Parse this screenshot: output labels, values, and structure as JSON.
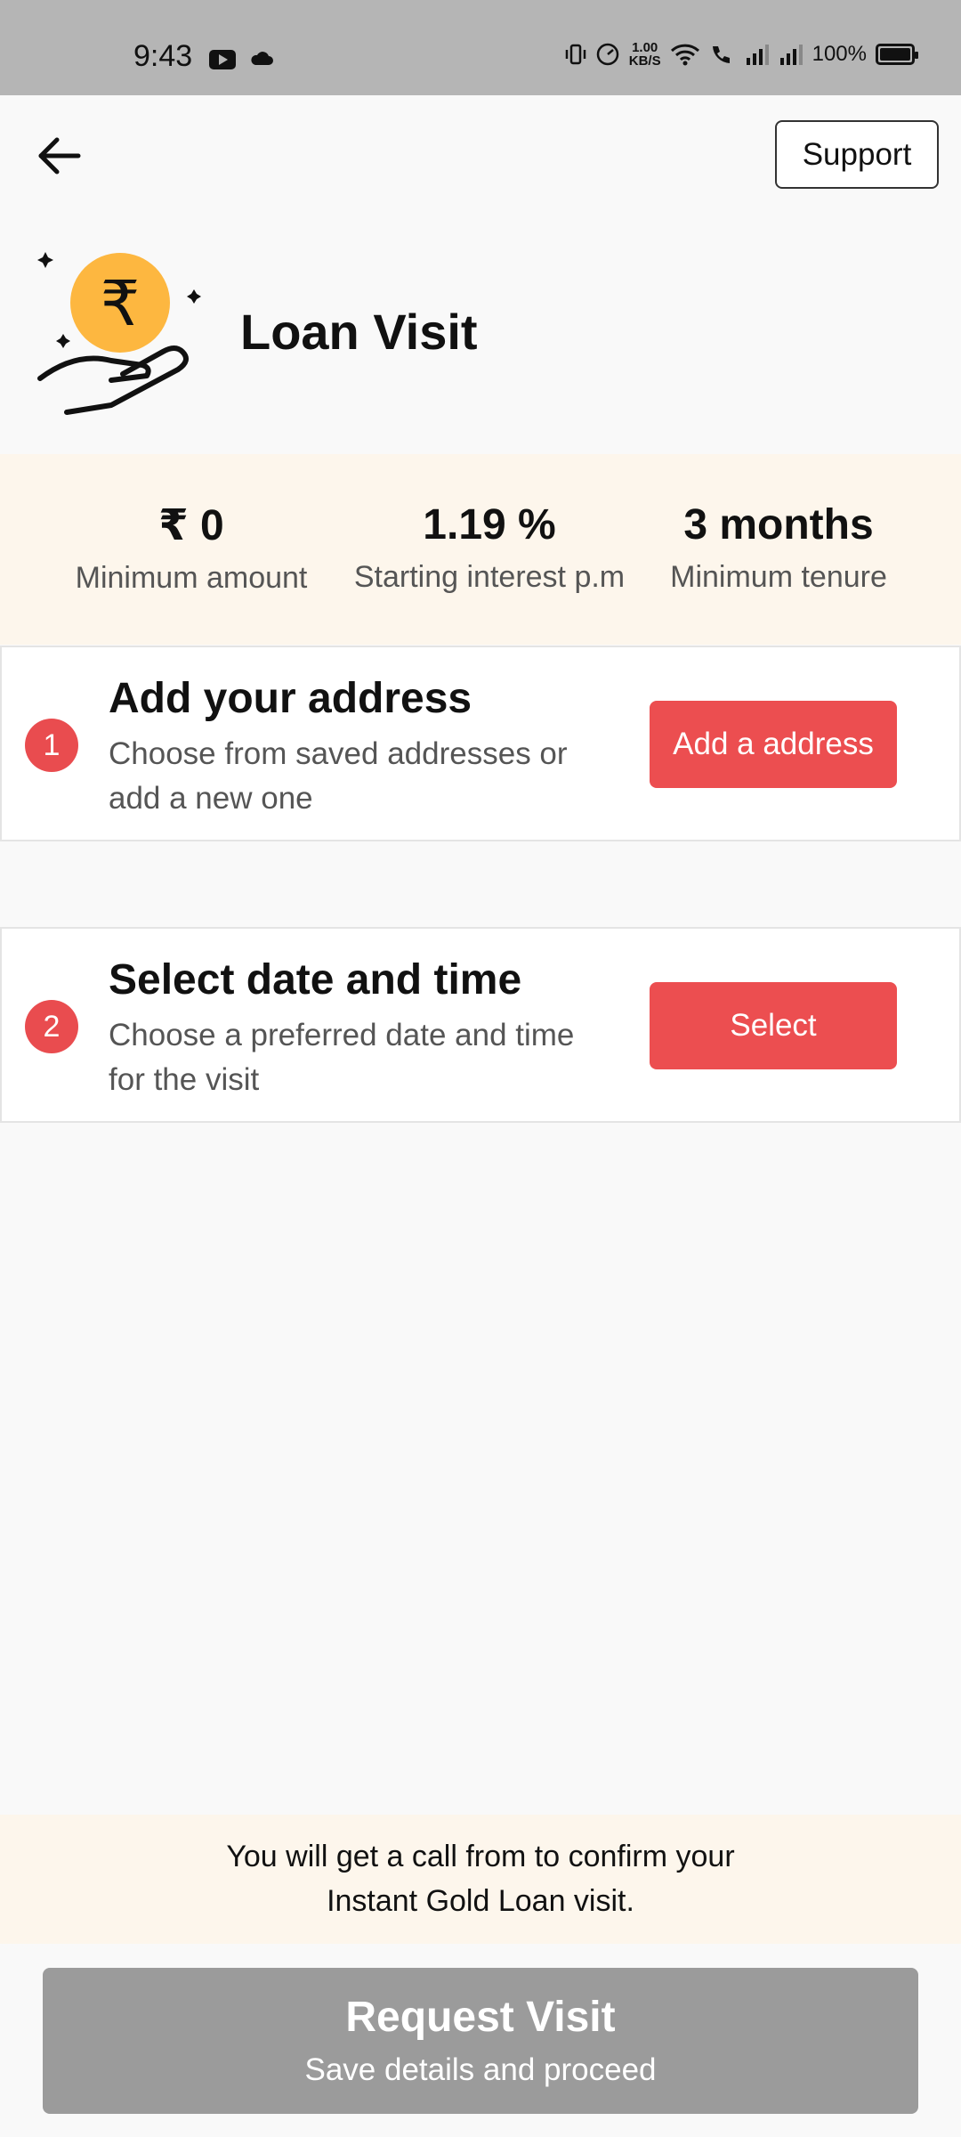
{
  "status_bar": {
    "time": "9:43",
    "speed_value": "1.00",
    "speed_unit": "KB/S",
    "battery_percent": "100%"
  },
  "header": {
    "back_icon": "arrow-left-icon",
    "support_label": "Support"
  },
  "hero": {
    "icon": "rupee-coin-hand-icon",
    "title": "Loan Visit"
  },
  "stats": [
    {
      "value": "₹ 0",
      "label": "Minimum amount"
    },
    {
      "value": "1.19 %",
      "label": "Starting interest p.m"
    },
    {
      "value": "3 months",
      "label": "Minimum tenure"
    }
  ],
  "steps": [
    {
      "number": "1",
      "title": "Add your address",
      "description": "Choose from saved addresses or add a new one",
      "button_label": "Add a address"
    },
    {
      "number": "2",
      "title": "Select date and time",
      "description": "Choose a preferred date and time for the visit",
      "button_label": "Select"
    }
  ],
  "notice": {
    "line1": "You will get a call from to confirm your",
    "line2": "Instant Gold Loan visit."
  },
  "request_button": {
    "title": "Request Visit",
    "subtitle": "Save details and proceed"
  },
  "colors": {
    "accent": "#ec4e50",
    "highlight_bg": "#fdf6ec",
    "disabled_button": "#9b9b9b",
    "coin": "#fdb740"
  }
}
